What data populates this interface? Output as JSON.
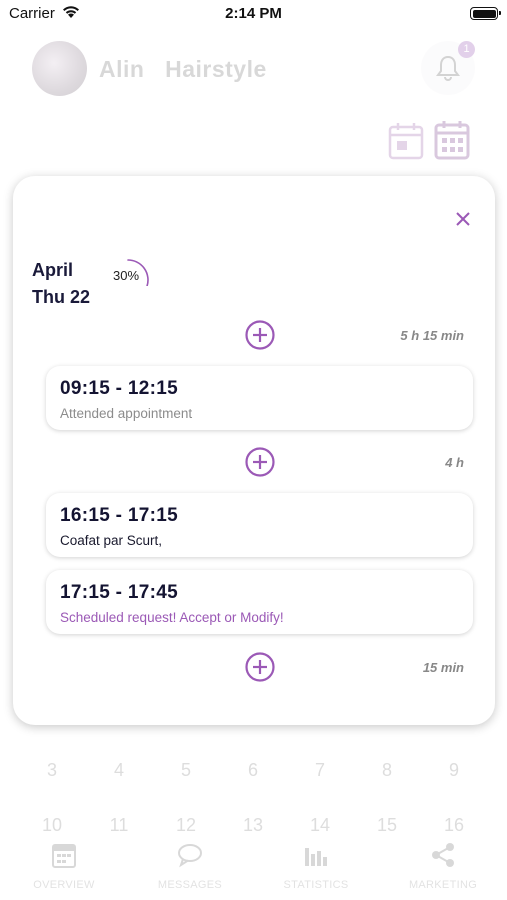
{
  "status_bar": {
    "carrier": "Carrier",
    "time": "2:14 PM"
  },
  "header": {
    "salon_name": "Alin   Hairstyle",
    "notification_count": "1"
  },
  "modal": {
    "month": "April",
    "date": "Thu 22",
    "progress_label": "30%",
    "progress_percent": 30,
    "gaps": [
      "5 h 15 min",
      "4 h",
      "15 min"
    ],
    "appointments": [
      {
        "time": "09:15 - 12:15",
        "description": "Attended appointment",
        "desc_color": "#8c8c8c"
      },
      {
        "time": "16:15 - 17:15",
        "description": "Coafat par Scurt,",
        "desc_color": "#1a1a2e"
      },
      {
        "time": "17:15 - 17:45",
        "description": "Scheduled request! Accept or Modify!",
        "desc_color": "#9b59b6"
      }
    ]
  },
  "calendar": {
    "row1": [
      "3",
      "4",
      "5",
      "6",
      "7",
      "8",
      "9"
    ],
    "row2": [
      "10",
      "11",
      "12",
      "13",
      "14",
      "15",
      "16"
    ]
  },
  "bottom_nav": [
    {
      "label": "OVERVIEW",
      "icon": "calendar-icon"
    },
    {
      "label": "MESSAGES",
      "icon": "chat-icon"
    },
    {
      "label": "STATISTICS",
      "icon": "bar-chart-icon"
    },
    {
      "label": "MARKETING",
      "icon": "share-icon"
    }
  ],
  "colors": {
    "accent": "#9b59b6",
    "text_dark": "#1a1a3a",
    "muted": "#888888"
  }
}
